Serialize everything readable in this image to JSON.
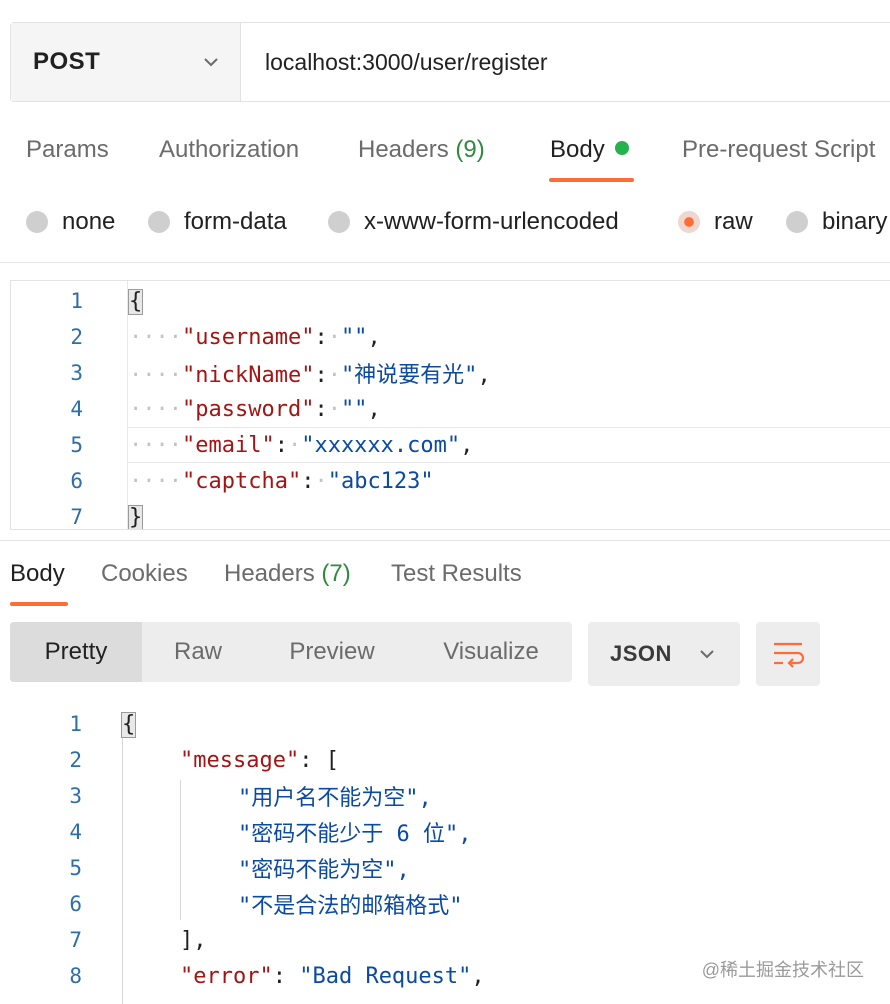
{
  "request": {
    "method": "POST",
    "url": "localhost:3000/user/register"
  },
  "request_tabs": {
    "params": "Params",
    "authorization": "Authorization",
    "headers": "Headers",
    "headers_count": "(9)",
    "body": "Body",
    "pre_request": "Pre-request Script"
  },
  "body_types": {
    "none": "none",
    "form_data": "form-data",
    "urlencoded": "x-www-form-urlencoded",
    "raw": "raw",
    "binary": "binary",
    "selected": "raw"
  },
  "request_body": {
    "lines": [
      "1",
      "2",
      "3",
      "4",
      "5",
      "6",
      "7"
    ],
    "open": "{",
    "close": "}",
    "fields": [
      {
        "key": "\"username\"",
        "value": "\"\"",
        "trail": ","
      },
      {
        "key": "\"nickName\"",
        "value": "\"神说要有光\"",
        "trail": ","
      },
      {
        "key": "\"password\"",
        "value": "\"\"",
        "trail": ","
      },
      {
        "key": "\"email\"",
        "value": "\"xxxxxx.com\"",
        "trail": ","
      },
      {
        "key": "\"captcha\"",
        "value": "\"abc123\"",
        "trail": ""
      }
    ]
  },
  "response_tabs": {
    "body": "Body",
    "cookies": "Cookies",
    "headers": "Headers",
    "headers_count": "(7)",
    "test_results": "Test Results"
  },
  "response_toolbar": {
    "pretty": "Pretty",
    "raw": "Raw",
    "preview": "Preview",
    "visualize": "Visualize",
    "format": "JSON"
  },
  "response_body": {
    "lines": [
      "1",
      "2",
      "3",
      "4",
      "5",
      "6",
      "7",
      "8"
    ],
    "open": "{",
    "message_key": "\"message\"",
    "message_open": "[",
    "messages": [
      "\"用户名不能为空\",",
      "\"密码不能少于 6 位\",",
      "\"密码不能为空\",",
      "\"不是合法的邮箱格式\""
    ],
    "message_close": "],",
    "error_key": "\"error\"",
    "error_value": "\"Bad Request\""
  },
  "watermark": "@稀土掘金技术社区",
  "colors": {
    "accent": "#ff6c37",
    "key": "#a31515",
    "string": "#0b4aa2",
    "line_number": "#2c6fa8",
    "count": "#2f8a3f",
    "dot": "#26b14f"
  }
}
